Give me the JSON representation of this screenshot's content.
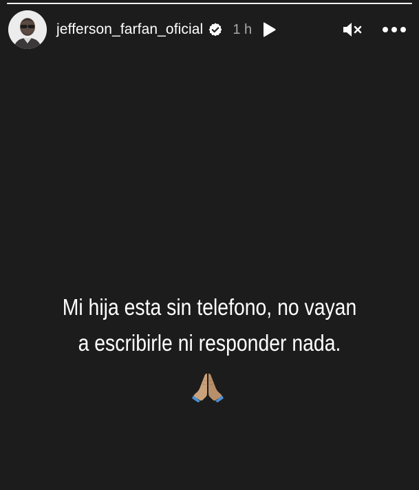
{
  "story": {
    "progress": 1.0,
    "header": {
      "username": "jefferson_farfan_oficial",
      "verified": true,
      "time_ago": "1 h",
      "icons": [
        "play-icon",
        "mute-icon",
        "more-icon"
      ]
    },
    "caption": {
      "line1": "Mi hija esta sin telefono, no vayan",
      "line2": "a escribirle ni responder nada."
    },
    "emoji": "folded-hands-emoji"
  },
  "colors": {
    "background": "#1c1c1c",
    "text": "#ffffff",
    "muted": "#a8a8a8"
  }
}
